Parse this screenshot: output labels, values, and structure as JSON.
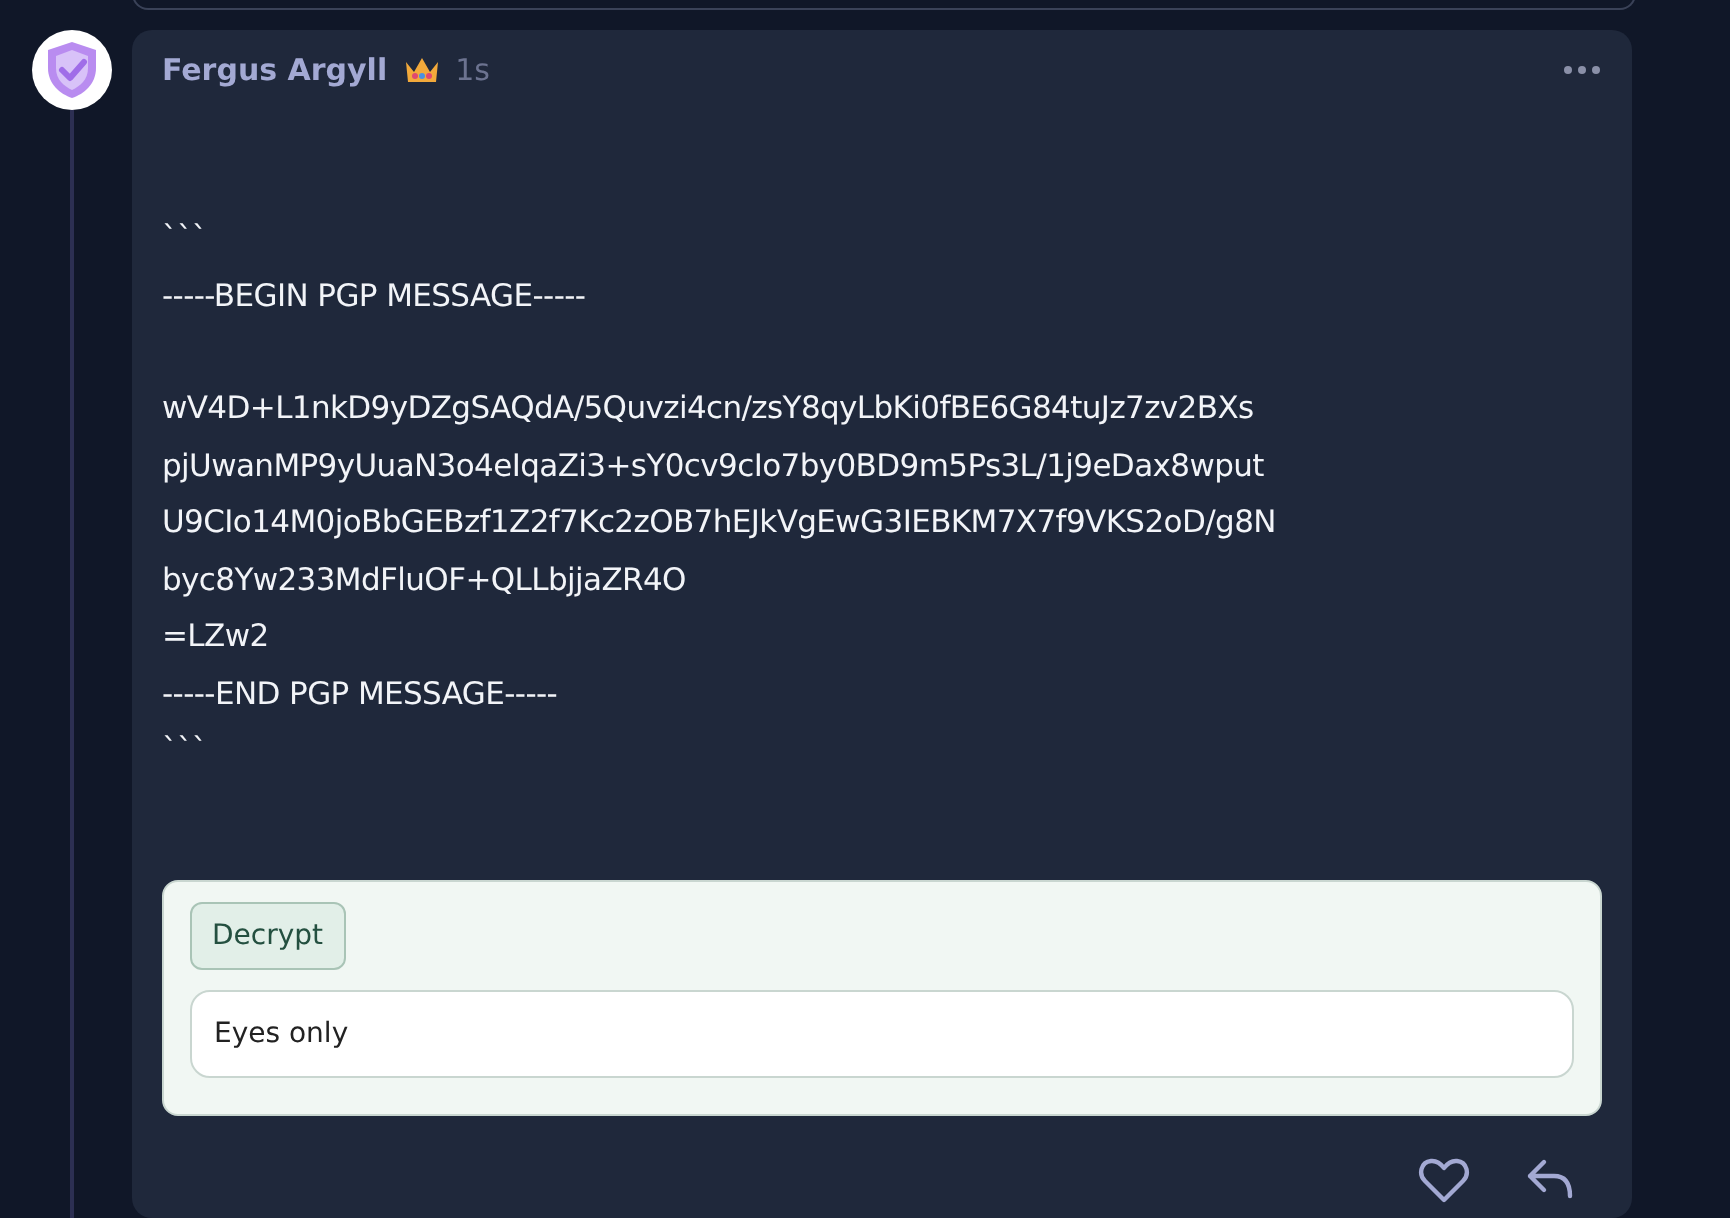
{
  "post": {
    "author": "Fergus Argyll",
    "time": "1s",
    "message_blocks": [
      {
        "lines": [
          "```",
          "-----BEGIN PGP MESSAGE-----"
        ]
      },
      {
        "lines": [
          "wV4D+L1nkD9yDZgSAQdA/5Quvzi4cn/zsY8qyLbKi0fBE6G84tuJz7zv2BXs",
          "pjUwanMP9yUuaN3o4eIqaZi3+sY0cv9cIo7by0BD9m5Ps3L/1j9eDax8wput",
          "U9CIo14M0joBbGEBzf1Z2f7Kc2zOB7hEJkVgEwG3IEBKM7X7f9VKS2oD/g8N",
          "byc8Yw233MdFluOF+QLLbjjaZR4O",
          "=LZw2",
          "-----END PGP MESSAGE-----",
          "```"
        ]
      }
    ],
    "decrypt": {
      "button": "Decrypt",
      "output": "Eyes only"
    }
  }
}
